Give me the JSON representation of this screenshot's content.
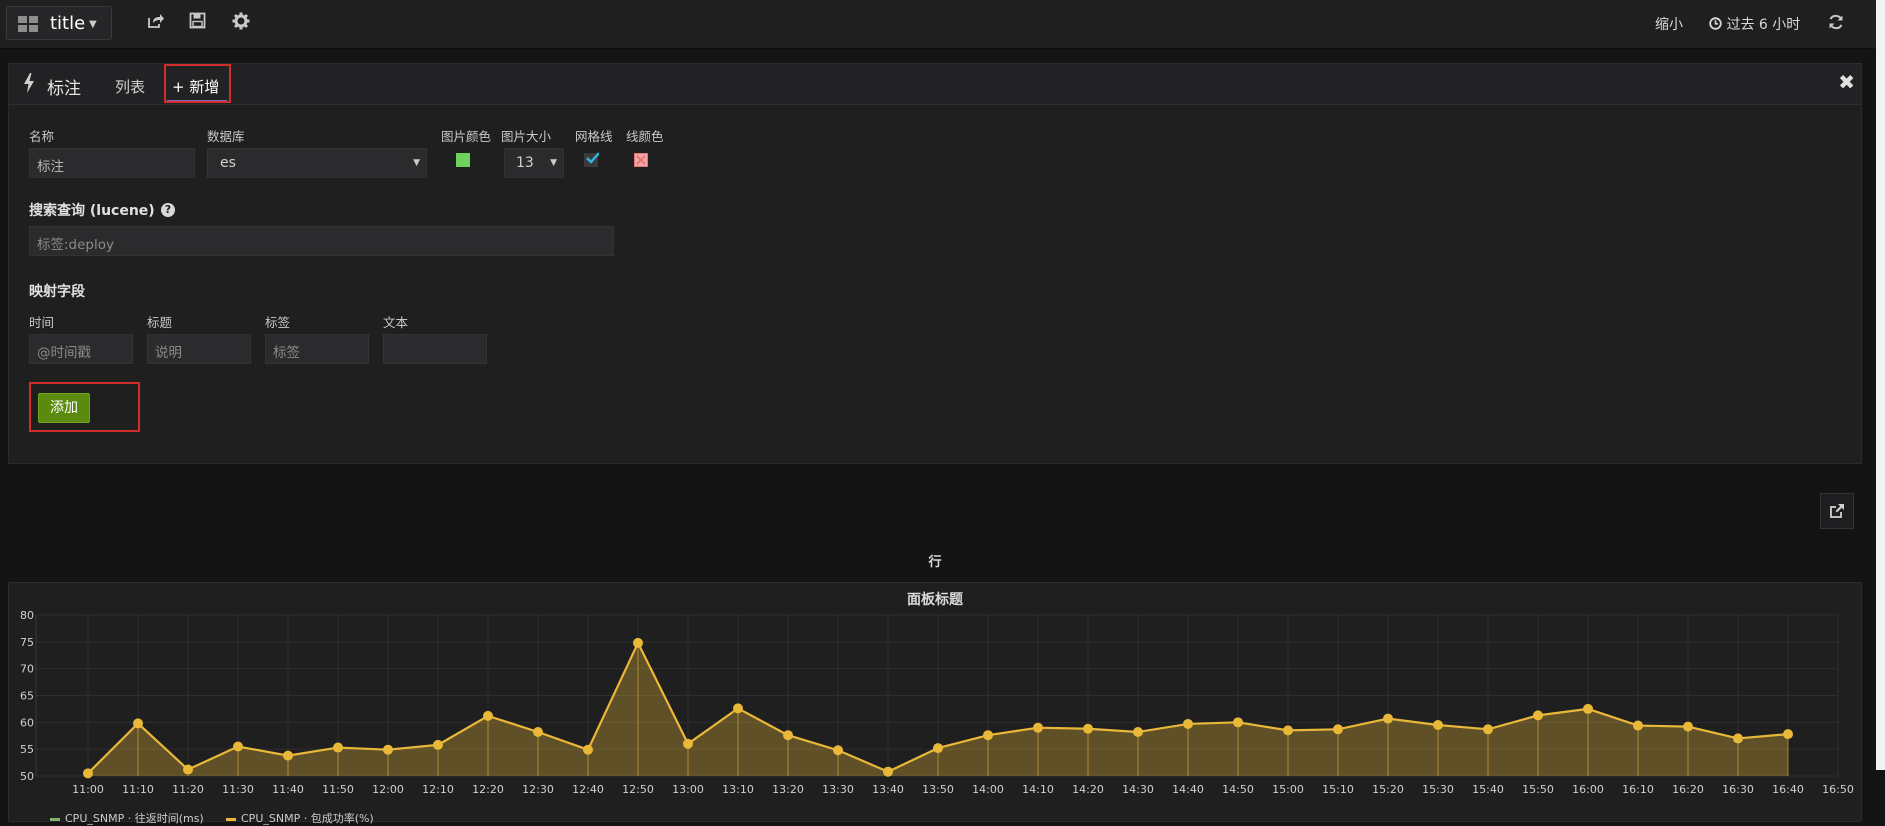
{
  "navbar": {
    "dashboard_title": "title",
    "zoom_out": "缩小",
    "time_range": "过去 6 小时",
    "icons": [
      "dashboard-grid-icon",
      "share-icon",
      "save-icon",
      "settings-gear-icon",
      "clock-icon",
      "refresh-icon"
    ]
  },
  "editor": {
    "header_title": "标注",
    "tab_list": "列表",
    "tab_new": "+ 新增",
    "fields": {
      "name_label": "名称",
      "name_value": "标注",
      "datasource_label": "数据库",
      "datasource_value": "es",
      "icon_color_label": "图片颜色",
      "icon_size_label": "图片大小",
      "icon_size_value": "13",
      "grid_line_label": "网格线",
      "line_color_label": "线颜色"
    },
    "colors": {
      "icon_color": "#6ed25a",
      "line_color": "#f4a4a4",
      "checkbox": "#33b5e5"
    },
    "query_title": "搜索查询 (lucene)",
    "query_placeholder": "标签:deploy",
    "mapping_title": "映射字段",
    "mapping": {
      "time_label": "时间",
      "time_placeholder": "@时间戳",
      "title_label": "标题",
      "title_placeholder": "说明",
      "tags_label": "标签",
      "tags_placeholder": "标签",
      "text_label": "文本",
      "text_placeholder": ""
    },
    "add_button": "添加"
  },
  "row_title": "行",
  "panel_title": "面板标题",
  "legend": [
    {
      "name": "CPU_SNMP · 往返时间(ms)",
      "color": "#7eb26d"
    },
    {
      "name": "CPU_SNMP · 包成功率(%)",
      "color": "#eab839"
    }
  ],
  "chart_data": {
    "type": "area",
    "title": "面板标题",
    "x": [
      "11:00",
      "11:10",
      "11:20",
      "11:30",
      "11:40",
      "11:50",
      "12:00",
      "12:10",
      "12:20",
      "12:30",
      "12:40",
      "12:50",
      "13:00",
      "13:10",
      "13:20",
      "13:30",
      "13:40",
      "13:50",
      "14:00",
      "14:10",
      "14:20",
      "14:30",
      "14:40",
      "14:50",
      "15:00",
      "15:10",
      "15:20",
      "15:30",
      "15:40",
      "15:50",
      "16:00",
      "16:10",
      "16:20",
      "16:30",
      "16:40"
    ],
    "x_ticks": [
      "11:00",
      "11:10",
      "11:20",
      "11:30",
      "11:40",
      "11:50",
      "12:00",
      "12:10",
      "12:20",
      "12:30",
      "12:40",
      "12:50",
      "13:00",
      "13:10",
      "13:20",
      "13:30",
      "13:40",
      "13:50",
      "14:00",
      "14:10",
      "14:20",
      "14:30",
      "14:40",
      "14:50",
      "15:00",
      "15:10",
      "15:20",
      "15:30",
      "15:40",
      "15:50",
      "16:00",
      "16:10",
      "16:20",
      "16:30",
      "16:40",
      "16:50"
    ],
    "y_ticks": [
      50,
      55,
      60,
      65,
      70,
      75,
      80
    ],
    "ylim": [
      50,
      80
    ],
    "grid": true,
    "legend_position": "bottom-left",
    "series": [
      {
        "name": "CPU_SNMP · 包成功率(%)",
        "color": "#eab839",
        "values": [
          50.5,
          59.8,
          51.2,
          55.5,
          53.8,
          55.3,
          54.9,
          55.8,
          61.2,
          58.2,
          54.9,
          74.8,
          56.0,
          62.6,
          57.6,
          54.8,
          50.8,
          55.2,
          57.6,
          59.0,
          58.8,
          58.2,
          59.7,
          60.0,
          58.5,
          58.7,
          60.7,
          59.5,
          58.7,
          61.3,
          62.5,
          59.4,
          59.2,
          57.0,
          57.8
        ]
      }
    ]
  }
}
